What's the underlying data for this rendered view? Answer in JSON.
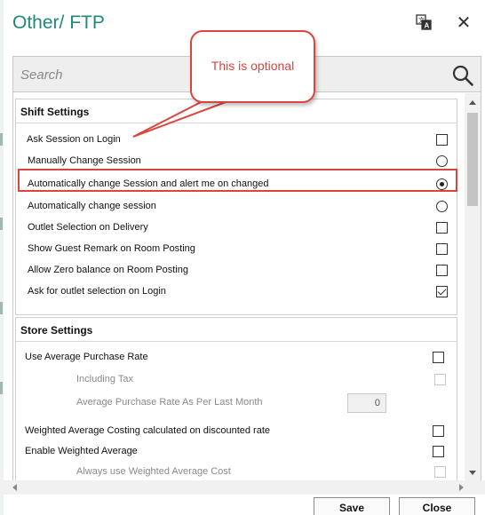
{
  "window": {
    "title": "Other/ FTP",
    "translate_icon": "translate-icon",
    "close_icon": "close-icon",
    "close_glyph": "✕"
  },
  "search": {
    "placeholder": "Search",
    "icon": "search-icon"
  },
  "shift_settings": {
    "title": "Shift Settings",
    "items": [
      {
        "label": "Ask Session on Login",
        "control": "checkbox",
        "checked": false
      },
      {
        "label": "Manually Change Session",
        "control": "radio",
        "checked": false
      },
      {
        "label": "Automatically change Session and alert me on changed",
        "control": "radio",
        "checked": true
      },
      {
        "label": "Automatically change session",
        "control": "radio",
        "checked": false
      },
      {
        "label": "Outlet Selection on Delivery",
        "control": "checkbox",
        "checked": false
      },
      {
        "label": "Show Guest Remark on Room Posting",
        "control": "checkbox",
        "checked": false
      },
      {
        "label": "Allow Zero balance on Room Posting",
        "control": "checkbox",
        "checked": false
      },
      {
        "label": "Ask for outlet selection on Login",
        "control": "checkbox",
        "checked": true
      }
    ]
  },
  "store_settings": {
    "title": "Store Settings",
    "items": [
      {
        "label": "Use Average Purchase Rate",
        "control": "checkbox",
        "checked": false
      },
      {
        "label": "Including Tax",
        "control": "checkbox",
        "checked": false,
        "disabled": true
      },
      {
        "label": "Average Purchase Rate As Per Last Month",
        "control": "number",
        "value": "0",
        "disabled": true
      },
      {
        "label": "Weighted Average Costing calculated on discounted rate",
        "control": "checkbox",
        "checked": false
      },
      {
        "label": "Enable Weighted Average",
        "control": "checkbox",
        "checked": false
      },
      {
        "label": "Always use Weighted Average Cost",
        "control": "checkbox",
        "checked": false,
        "disabled": true
      }
    ]
  },
  "annotation": {
    "text": "This is optional",
    "color": "#d9463e"
  },
  "buttons": {
    "save": "Save",
    "close": "Close"
  },
  "colors": {
    "title": "#1f8a78",
    "highlight": "#d9463e"
  }
}
